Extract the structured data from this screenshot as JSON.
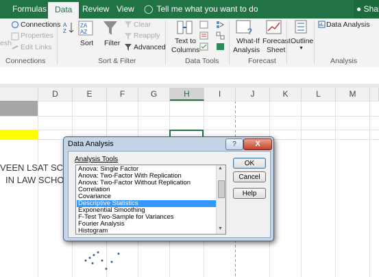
{
  "ribbon_tabs": [
    "Formulas",
    "Data",
    "Review",
    "View"
  ],
  "active_tab": "Data",
  "tell_me": "Tell me what you want to do",
  "user_name": "Shar",
  "get_data": {
    "partial_label": "esh",
    "connections": "Connections",
    "properties": "Properties",
    "edit_links": "Edit Links",
    "group": "Connections"
  },
  "sort_filter": {
    "sort": "Sort",
    "filter": "Filter",
    "clear": "Clear",
    "reapply": "Reapply",
    "advanced": "Advanced",
    "group": "Sort & Filter"
  },
  "data_tools": {
    "text_to": "Text to",
    "columns": "Columns",
    "group": "Data Tools"
  },
  "forecast": {
    "whatif_1": "What-If",
    "whatif_2": "Analysis",
    "sheet_1": "Forecast",
    "sheet_2": "Sheet",
    "group": "Forecast"
  },
  "outline": {
    "label": "Outline"
  },
  "analysis": {
    "data_analysis": "Data Analysis",
    "group": "Analysis"
  },
  "columns": [
    "D",
    "E",
    "F",
    "G",
    "H",
    "I",
    "J",
    "K",
    "L",
    "M"
  ],
  "selected_column": "H",
  "sheet_text": {
    "line1": "VEEN LSAT SCORE",
    "line2": "IN LAW SCHOO"
  },
  "colors": {
    "excel_green": "#217346",
    "yellow_fill": "#ffff00",
    "gray_fill": "#a6a6a6",
    "selection_blue": "#3399ff"
  },
  "dialog": {
    "title": "Data Analysis",
    "help_glyph": "?",
    "close_glyph": "X",
    "list_label": "Analysis Tools",
    "items": [
      "Anova: Single Factor",
      "Anova: Two-Factor With Replication",
      "Anova: Two-Factor Without Replication",
      "Correlation",
      "Covariance",
      "Descriptive Statistics",
      "Exponential Smoothing",
      "F-Test Two-Sample for Variances",
      "Fourier Analysis",
      "Histogram"
    ],
    "selected_item": "Descriptive Statistics",
    "ok": "OK",
    "cancel": "Cancel",
    "help": "Help"
  }
}
